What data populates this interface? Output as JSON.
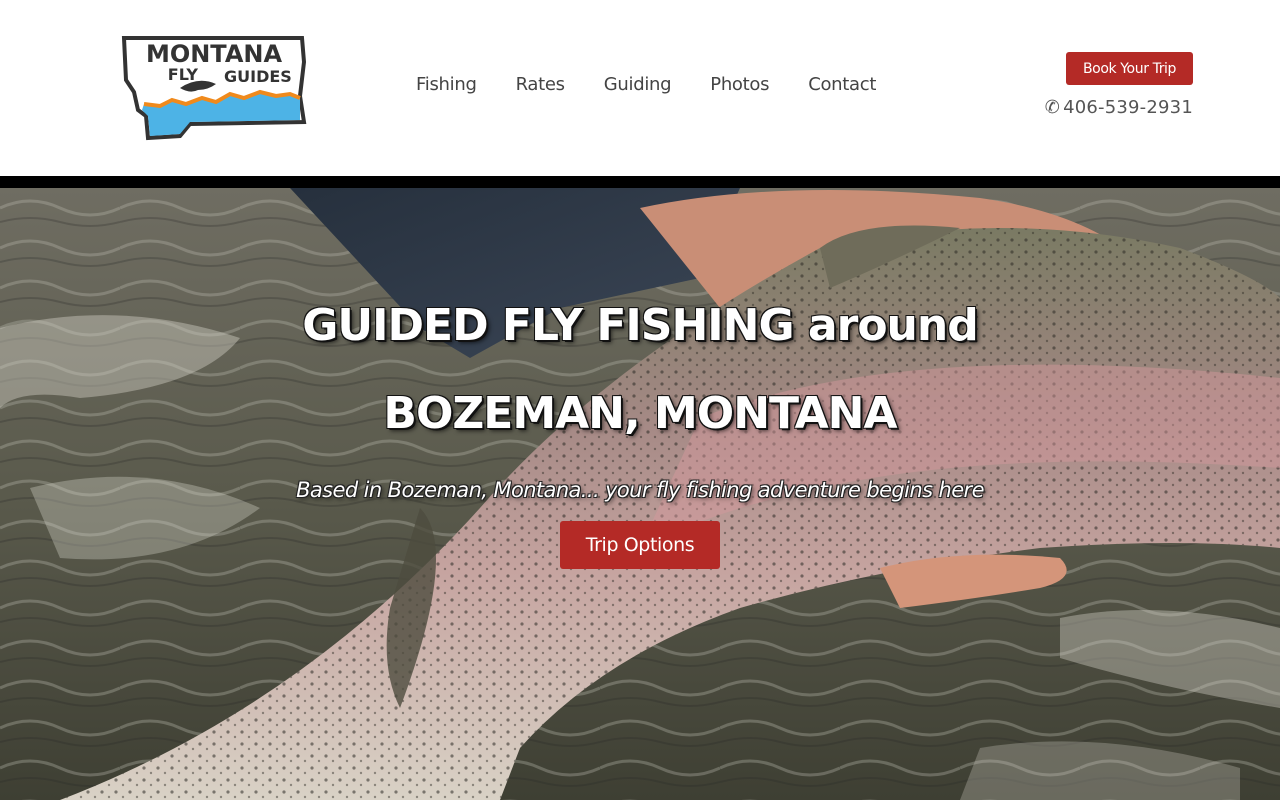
{
  "logo": {
    "line1": "MONTANA",
    "line2": "FLY",
    "line3": "GUIDES"
  },
  "nav": {
    "items": [
      {
        "label": "Fishing"
      },
      {
        "label": "Rates"
      },
      {
        "label": "Guiding"
      },
      {
        "label": "Photos"
      },
      {
        "label": "Contact"
      }
    ]
  },
  "header": {
    "book_label": "Book Your Trip",
    "phone_icon": "phone-icon",
    "phone_symbol": "✆",
    "phone": "406-539-2931"
  },
  "hero": {
    "title_line1": "GUIDED FLY FISHING around",
    "title_line2": "BOZEMAN, MONTANA",
    "subtitle": "Based in Bozeman, Montana... your fly fishing adventure begins here",
    "cta_label": "Trip Options",
    "image_subject": "hand-holding-rainbow-trout-in-river"
  },
  "colors": {
    "accent": "#b42a26",
    "nav_text": "#444444",
    "logo_blue": "#4db3e6",
    "logo_orange": "#f08a1c",
    "logo_dark": "#333333"
  }
}
